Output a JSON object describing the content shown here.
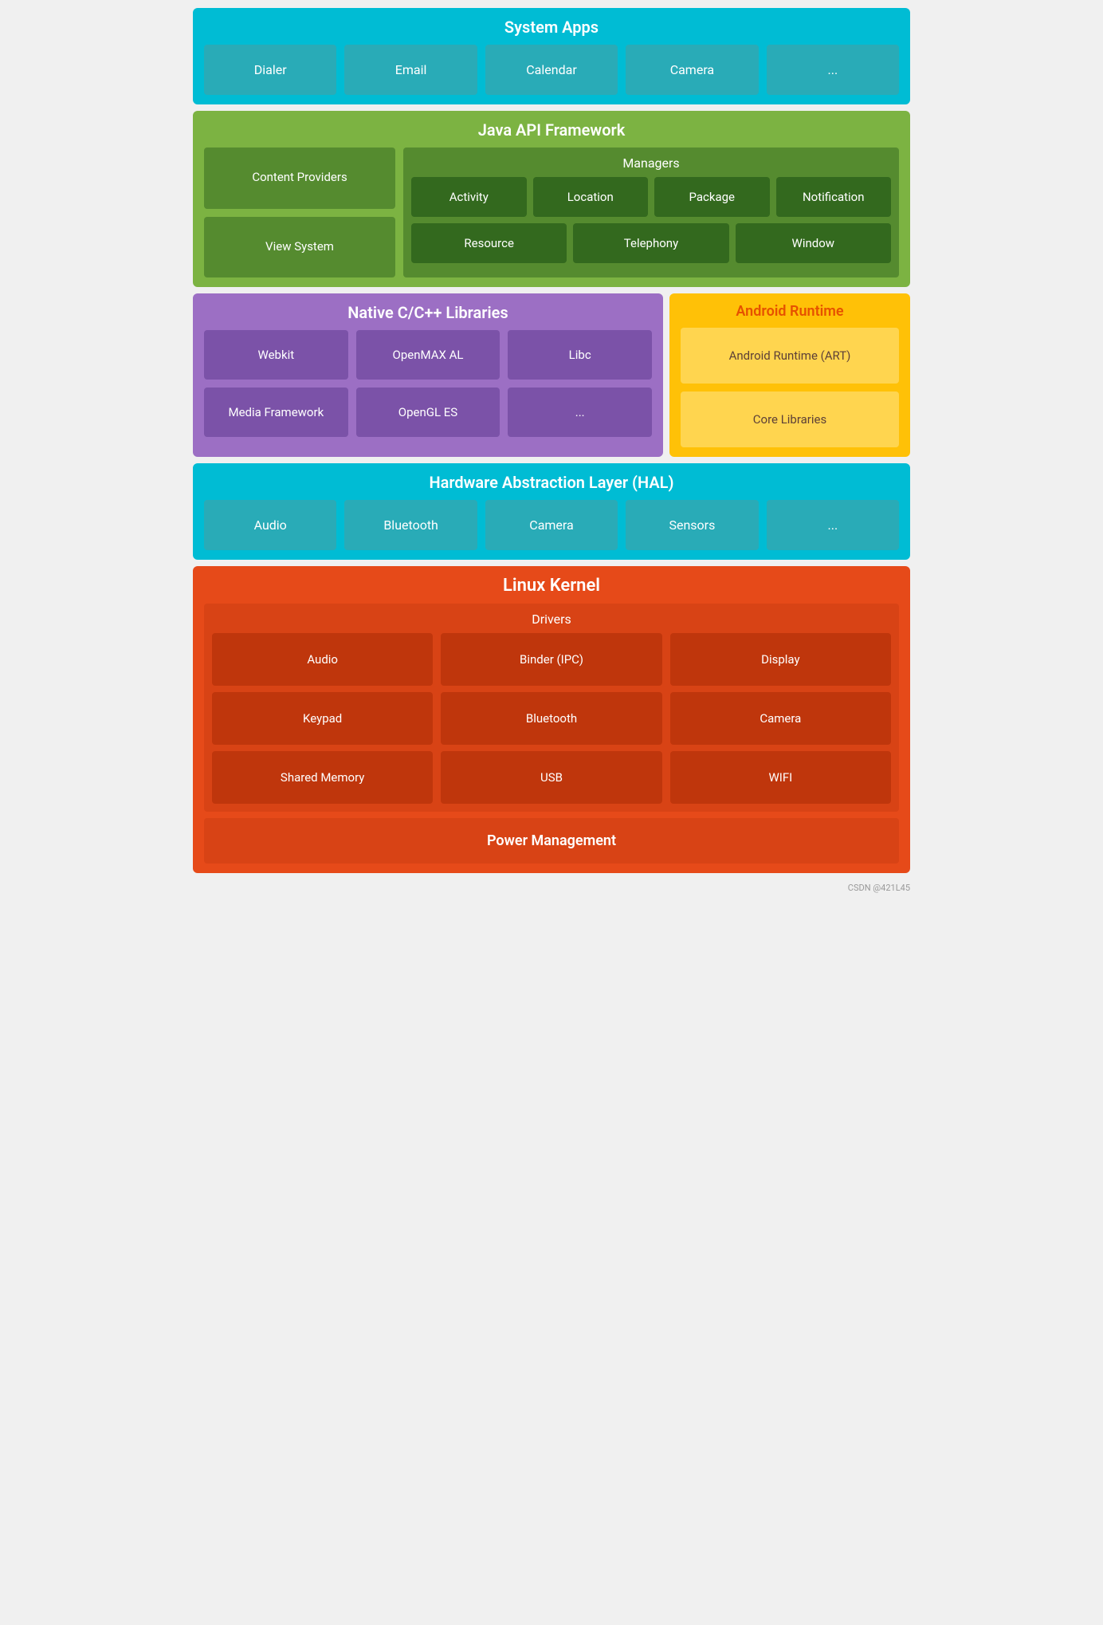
{
  "system_apps": {
    "title": "System Apps",
    "items": [
      "Dialer",
      "Email",
      "Calendar",
      "Camera",
      "..."
    ]
  },
  "java_api": {
    "title": "Java API Framework",
    "left_items": [
      "Content Providers",
      "View System"
    ],
    "managers_title": "Managers",
    "managers_row1": [
      "Activity",
      "Location",
      "Package",
      "Notification"
    ],
    "managers_row2": [
      "Resource",
      "Telephony",
      "Window"
    ]
  },
  "native_libs": {
    "title": "Native C/C++ Libraries",
    "row1": [
      "Webkit",
      "OpenMAX AL",
      "Libc"
    ],
    "row2": [
      "Media Framework",
      "OpenGL ES",
      "..."
    ]
  },
  "android_runtime": {
    "title": "Android Runtime",
    "items": [
      "Android Runtime (ART)",
      "Core Libraries"
    ]
  },
  "hal": {
    "title": "Hardware Abstraction Layer (HAL)",
    "items": [
      "Audio",
      "Bluetooth",
      "Camera",
      "Sensors",
      "..."
    ]
  },
  "linux_kernel": {
    "title": "Linux Kernel",
    "drivers_title": "Drivers",
    "driver_rows": [
      [
        "Audio",
        "Binder (IPC)",
        "Display"
      ],
      [
        "Keypad",
        "Bluetooth",
        "Camera"
      ],
      [
        "Shared Memory",
        "USB",
        "WIFI"
      ]
    ],
    "power_management": "Power Management"
  },
  "watermark": "CSDN @421L45"
}
